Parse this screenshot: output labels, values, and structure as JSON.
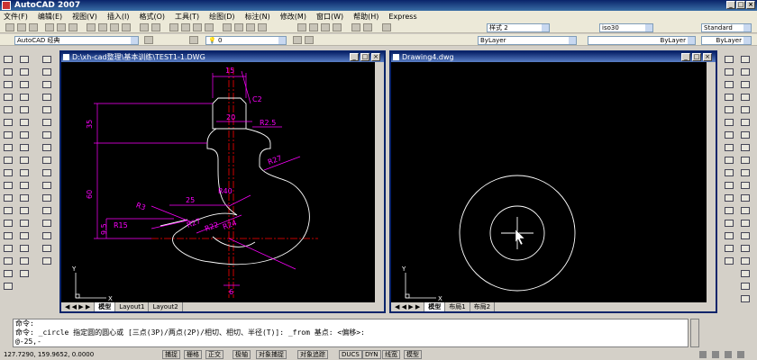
{
  "app": {
    "title": "AutoCAD 2007"
  },
  "menu": [
    "文件(F)",
    "编辑(E)",
    "视图(V)",
    "插入(I)",
    "格式(O)",
    "工具(T)",
    "绘图(D)",
    "标注(N)",
    "修改(M)",
    "窗口(W)",
    "帮助(H)",
    "Express"
  ],
  "toolbar": {
    "workspace": "AutoCAD 经典",
    "text_style": "样式 2",
    "dim_style": "iso30",
    "table_style": "Standard",
    "layer_value": "0",
    "color_value": "ByLayer",
    "linetype_value": "ByLayer",
    "lineweight_value": "ByLayer"
  },
  "window_left": {
    "title": "D:\\xh-cad整理\\基本训练\\TEST1-1.DWG",
    "tabs": [
      "模型",
      "Layout1",
      "Layout2"
    ],
    "dims": {
      "top_width": "15",
      "chamfer": "C2",
      "neck_width": "20",
      "neck_radius": "R2.5",
      "height_35": "35",
      "height_60": "60",
      "radius_27_right": "R27",
      "radius_40": "R40",
      "width_25": "25",
      "radius_27_inner": "R27",
      "radius_3": "R3",
      "radius_15": "R15",
      "height_9": "9.5",
      "radius_22": "R22",
      "radius_24": "R24",
      "bottom_width": "6"
    },
    "ucs_x": "X",
    "ucs_y": "Y"
  },
  "window_right": {
    "title": "Drawing4.dwg",
    "tabs": [
      "模型",
      "布局1",
      "布局2"
    ],
    "ucs_x": "X",
    "ucs_y": "Y"
  },
  "command": {
    "line1": "命令:",
    "line2": "命令: _circle 指定圆的圆心或 [三点(3P)/两点(2P)/相切、相切、半径(T)]: _from 基点: <偏移>:",
    "line3": "@-25,-"
  },
  "status": {
    "coords": "127.7290, 159.9652, 0.0000",
    "buttons": [
      "捕捉",
      "栅格",
      "正交",
      "极轴",
      "对象捕捉",
      "对象追踪",
      "DUCS",
      "DYN",
      "线宽",
      "模型"
    ]
  },
  "colors": {
    "dim": "#ff00ff",
    "center": "#ff0000",
    "outline": "#ffffff",
    "bg": "#000000"
  }
}
